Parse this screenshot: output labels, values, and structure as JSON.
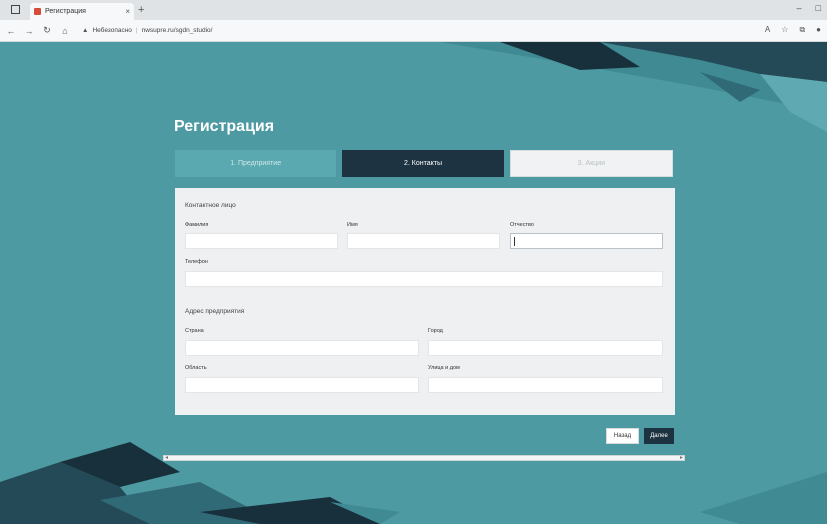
{
  "browser": {
    "tab_title": "Регистрация",
    "tab_close": "×",
    "new_tab": "+",
    "url_warning": "Небезопасно",
    "url": "nwsupre.ru/sgdn_studio/",
    "window_controls": [
      "–",
      "□"
    ]
  },
  "page": {
    "title": "Регистрация"
  },
  "steps": [
    {
      "label": "1. Предприятие",
      "state": "done"
    },
    {
      "label": "2. Контакты",
      "state": "active"
    },
    {
      "label": "3. Акции",
      "state": "pending"
    }
  ],
  "form": {
    "contact_section": "Контактное лицо",
    "surname_label": "Фамилия",
    "name_label": "Имя",
    "patronymic_label": "Отчество",
    "phone_label": "Телефон",
    "address_section": "Адрес предприятия",
    "country_label": "Страна",
    "city_label": "Город",
    "region_label": "Область",
    "street_label": "Улица и дом"
  },
  "buttons": {
    "back": "Назад",
    "next": "Далее"
  },
  "colors": {
    "background": "#4d9aa3",
    "accent_dark": "#1e3341",
    "step_done": "#5aa9b0"
  }
}
